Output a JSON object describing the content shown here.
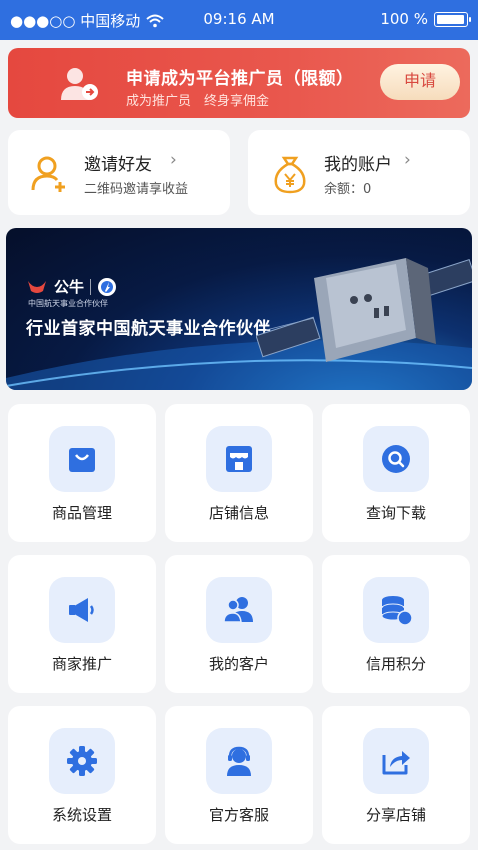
{
  "status_bar": {
    "carrier": "●●●○○ 中国移动",
    "time": "09:16 AM",
    "battery": "100 %",
    "battery_level": 1.0
  },
  "promo": {
    "title": "申请成为平台推广员（限额）",
    "subtitle": "成为推广员　终身享佣金",
    "button": "申请"
  },
  "quick_actions": [
    {
      "title": "邀请好友",
      "subtitle": "二维码邀请享收益",
      "icon": "add-user-icon"
    },
    {
      "title": "我的账户",
      "subtitle": "余额：0",
      "icon": "money-bag-icon"
    }
  ],
  "banner": {
    "brand": "公牛",
    "brand_sub": "中国航天事业合作伙伴",
    "headline": "行业首家中国航天事业合作伙伴"
  },
  "grid": [
    {
      "label": "商品管理",
      "icon": "shopping-bag-icon"
    },
    {
      "label": "店铺信息",
      "icon": "storefront-icon"
    },
    {
      "label": "查询下载",
      "icon": "search-icon"
    },
    {
      "label": "商家推广",
      "icon": "megaphone-icon"
    },
    {
      "label": "我的客户",
      "icon": "customers-icon"
    },
    {
      "label": "信用积分",
      "icon": "coins-icon"
    },
    {
      "label": "系统设置",
      "icon": "gear-icon"
    },
    {
      "label": "官方客服",
      "icon": "support-agent-icon"
    },
    {
      "label": "分享店铺",
      "icon": "share-icon"
    }
  ],
  "colors": {
    "primary": "#2f6fe0",
    "promo_red": "#e5483f",
    "icon_bg": "#e6eefc",
    "icon_blue": "#2f6fe0",
    "orange": "#f0a020"
  }
}
